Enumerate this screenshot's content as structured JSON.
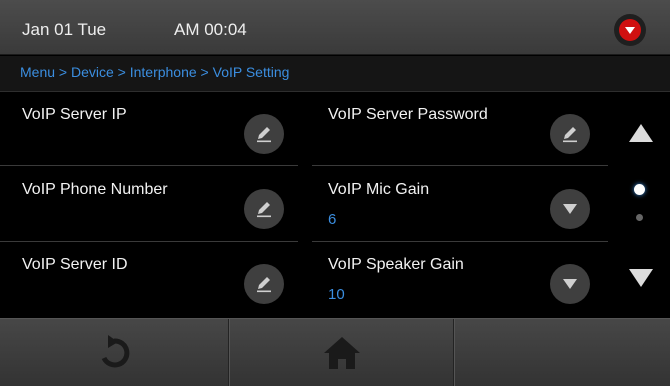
{
  "status": {
    "date": "Jan 01 Tue",
    "time": "AM 00:04"
  },
  "breadcrumb": {
    "text": "Menu > Device > Interphone > VoIP Setting"
  },
  "settings": [
    {
      "label": "VoIP Server IP",
      "value": "",
      "control": "edit-icon"
    },
    {
      "label": "VoIP Server Password",
      "value": "",
      "control": "edit-icon"
    },
    {
      "label": "VoIP Phone Number",
      "value": "",
      "control": "edit-icon"
    },
    {
      "label": "VoIP Mic Gain",
      "value": "6",
      "control": "dropdown-icon"
    },
    {
      "label": "VoIP Server ID",
      "value": "",
      "control": "edit-icon"
    },
    {
      "label": "VoIP Speaker Gain",
      "value": "10",
      "control": "dropdown-icon"
    }
  ],
  "pager": {
    "current_page": 1,
    "total_pages": 2
  },
  "colors": {
    "accent": "#3b8ee0",
    "alert": "#d01010",
    "active_dot": "#ffffff",
    "inactive_dot": "#666666"
  },
  "bottom_icons": [
    "back-icon",
    "home-icon"
  ]
}
